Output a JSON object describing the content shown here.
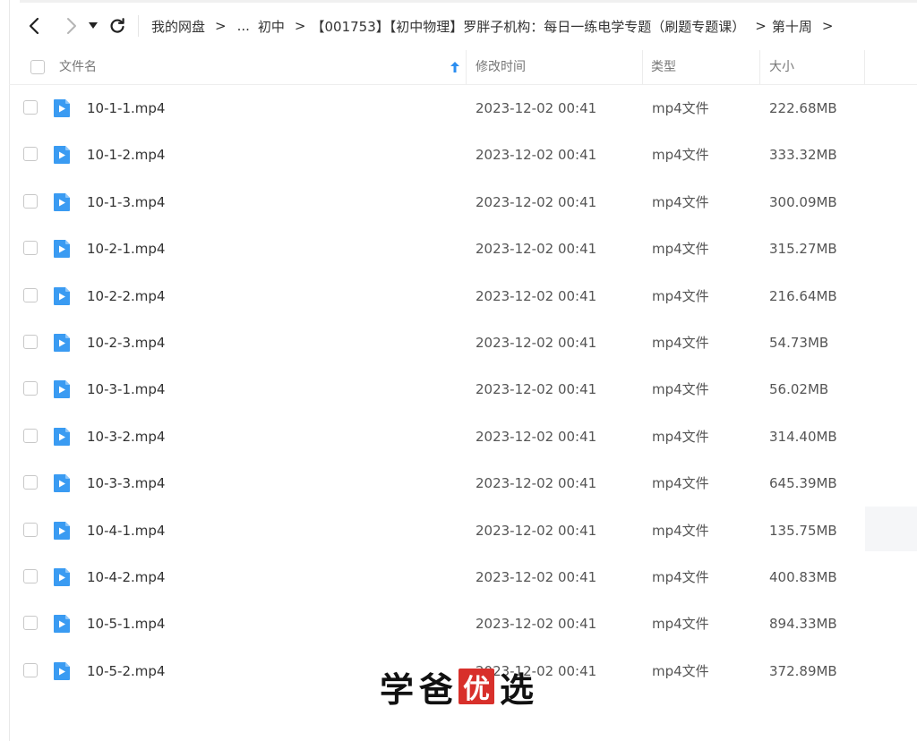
{
  "toolbar": {
    "back_icon": "chevron-left-icon",
    "forward_icon": "chevron-right-icon",
    "dropdown_icon": "caret-down-icon",
    "refresh_icon": "refresh-icon"
  },
  "breadcrumb": {
    "items": [
      "我的网盘",
      "...",
      "初中",
      "【001753】【初中物理】罗胖子机构：每日一练电学专题（刷题专题课）",
      "第十周"
    ],
    "separator": ">"
  },
  "table": {
    "columns": [
      "文件名",
      "修改时间",
      "类型",
      "大小"
    ],
    "sort_icon": "sort-up-arrow-icon",
    "rows": [
      {
        "name": "10-1-1.mp4",
        "modified": "2023-12-02 00:41",
        "type": "mp4文件",
        "size": "222.68MB"
      },
      {
        "name": "10-1-2.mp4",
        "modified": "2023-12-02 00:41",
        "type": "mp4文件",
        "size": "333.32MB"
      },
      {
        "name": "10-1-3.mp4",
        "modified": "2023-12-02 00:41",
        "type": "mp4文件",
        "size": "300.09MB"
      },
      {
        "name": "10-2-1.mp4",
        "modified": "2023-12-02 00:41",
        "type": "mp4文件",
        "size": "315.27MB"
      },
      {
        "name": "10-2-2.mp4",
        "modified": "2023-12-02 00:41",
        "type": "mp4文件",
        "size": "216.64MB"
      },
      {
        "name": "10-2-3.mp4",
        "modified": "2023-12-02 00:41",
        "type": "mp4文件",
        "size": "54.73MB"
      },
      {
        "name": "10-3-1.mp4",
        "modified": "2023-12-02 00:41",
        "type": "mp4文件",
        "size": "56.02MB"
      },
      {
        "name": "10-3-2.mp4",
        "modified": "2023-12-02 00:41",
        "type": "mp4文件",
        "size": "314.40MB"
      },
      {
        "name": "10-3-3.mp4",
        "modified": "2023-12-02 00:41",
        "type": "mp4文件",
        "size": "645.39MB"
      },
      {
        "name": "10-4-1.mp4",
        "modified": "2023-12-02 00:41",
        "type": "mp4文件",
        "size": "135.75MB"
      },
      {
        "name": "10-4-2.mp4",
        "modified": "2023-12-02 00:41",
        "type": "mp4文件",
        "size": "400.83MB"
      },
      {
        "name": "10-5-1.mp4",
        "modified": "2023-12-02 00:41",
        "type": "mp4文件",
        "size": "894.33MB"
      },
      {
        "name": "10-5-2.mp4",
        "modified": "2023-12-02 00:41",
        "type": "mp4文件",
        "size": "372.89MB"
      }
    ]
  },
  "watermark": {
    "chars": [
      "学",
      "爸",
      "优",
      "选"
    ]
  },
  "colors": {
    "accent": "#2b8ef0",
    "file_icon": "#3a9bf2",
    "seal": "#d8302b"
  }
}
